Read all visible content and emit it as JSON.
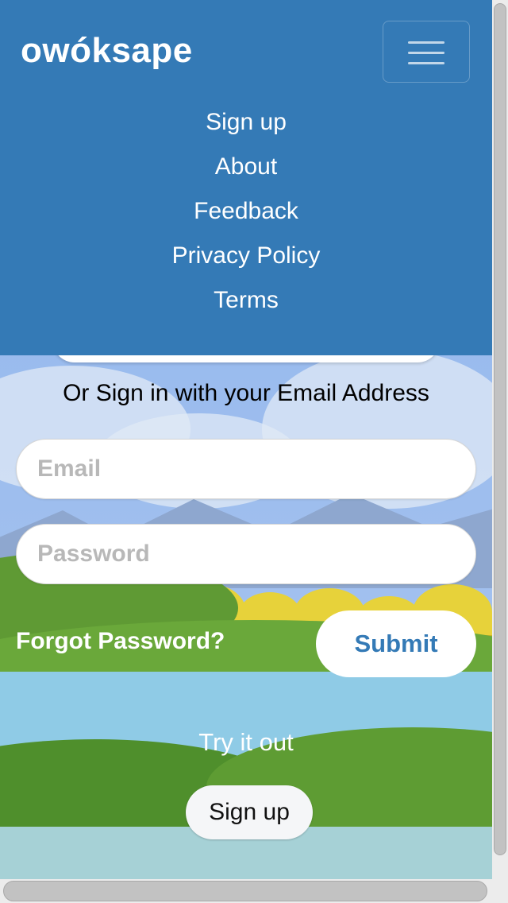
{
  "navbar": {
    "brand": "owóksape",
    "toggle_icon": "hamburger-menu-icon",
    "background_color": "#347ab6",
    "links": [
      {
        "label": "Sign up"
      },
      {
        "label": "About"
      },
      {
        "label": "Feedback"
      },
      {
        "label": "Privacy Policy"
      },
      {
        "label": "Terms"
      }
    ]
  },
  "login": {
    "or_text": "Or Sign in with your Email Address",
    "email_placeholder": "Email",
    "password_placeholder": "Password",
    "forgot_label": "Forgot Password?",
    "submit_label": "Submit",
    "submit_color": "#347ab6"
  },
  "cta": {
    "try_text": "Try it out",
    "signup_label": "Sign up"
  }
}
